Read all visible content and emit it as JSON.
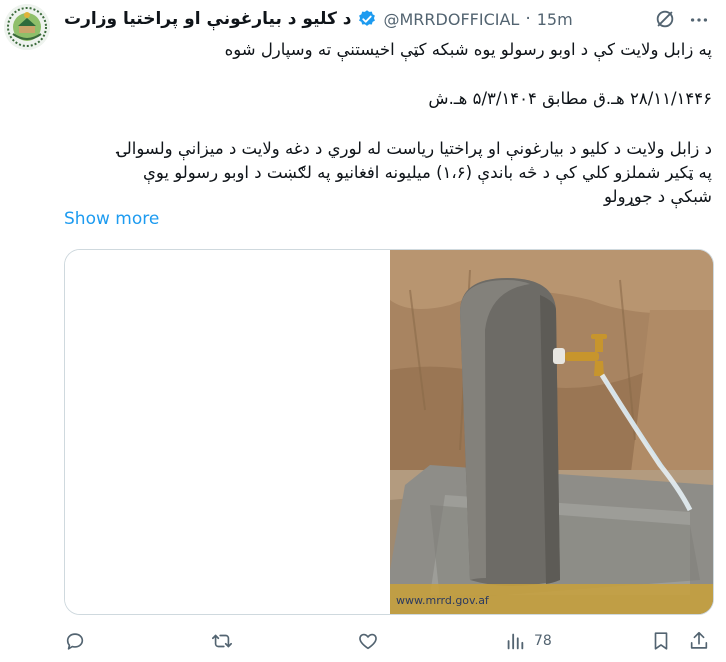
{
  "tweet": {
    "display_name": "د کلیو د بیارغونې او پراختیا وزارت",
    "handle": "@MRRDOFFICIAL",
    "separator": "·",
    "time": "15m",
    "lines": [
      "په زابل ولایت کې د اوبو رسولو یوه شبکه کټې اخیستنې ته وسپارل شوه",
      "۲۸/۱۱/۱۴۴۶ هـ.ق مطابق ۵/۳/۱۴۰۴ هـ.ش",
      "د زابل ولایت د کلیو د بیارغونې او پراختیا ریاست له لوري د دغه ولایت د میزانې ولسوالۍ",
      "په ټکیر شملزو کلي کې د څه باندې (۱،۶) میلیونه افغانیو په لګښت د اوبو رسولو یوې",
      "شبکې د جوړولو"
    ],
    "show_more": "Show more",
    "image_caption": "www.mrrd.gov.af"
  },
  "actions": {
    "views": "78"
  },
  "colors": {
    "accent": "#1d9bf0",
    "text": "#0f1419",
    "muted": "#536471",
    "border": "#cfd9de"
  },
  "icons": [
    "avatar-logo",
    "verified-badge-icon",
    "grok-icon",
    "more-icon",
    "reply-icon",
    "repost-icon",
    "like-icon",
    "views-icon",
    "bookmark-icon",
    "share-icon"
  ]
}
